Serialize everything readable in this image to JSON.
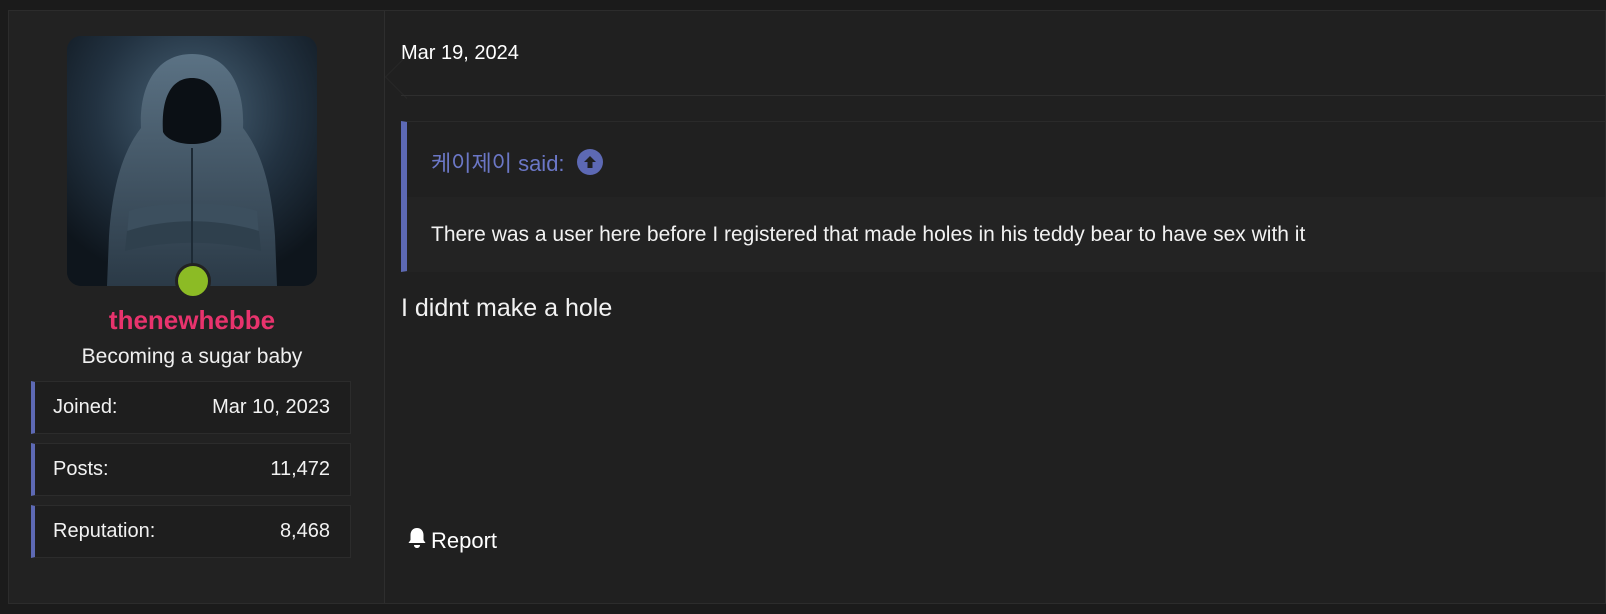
{
  "user": {
    "username": "thenewhebbe",
    "title": "Becoming a sugar baby",
    "avatar": "hooded-figure-avatar",
    "online": true,
    "stats": [
      {
        "label": "Joined:",
        "value": "Mar 10, 2023"
      },
      {
        "label": "Posts:",
        "value": "11,472"
      },
      {
        "label": "Reputation:",
        "value": "8,468"
      }
    ]
  },
  "post": {
    "date": "Mar 19, 2024",
    "quote": {
      "author_line": "케이제이 said:",
      "text": "There was a user here before I registered that made holes in his teddy bear to have sex with it"
    },
    "message": "I didnt make a hole",
    "report_label": "Report"
  },
  "colors": {
    "username": "#e8336d",
    "accent": "#5d69b4",
    "quote_author": "#6b77c6",
    "online": "#8cbb25",
    "background": "#202020"
  },
  "icons": {
    "quote_jump": "arrow-up-circle-icon",
    "report": "bell-icon"
  }
}
